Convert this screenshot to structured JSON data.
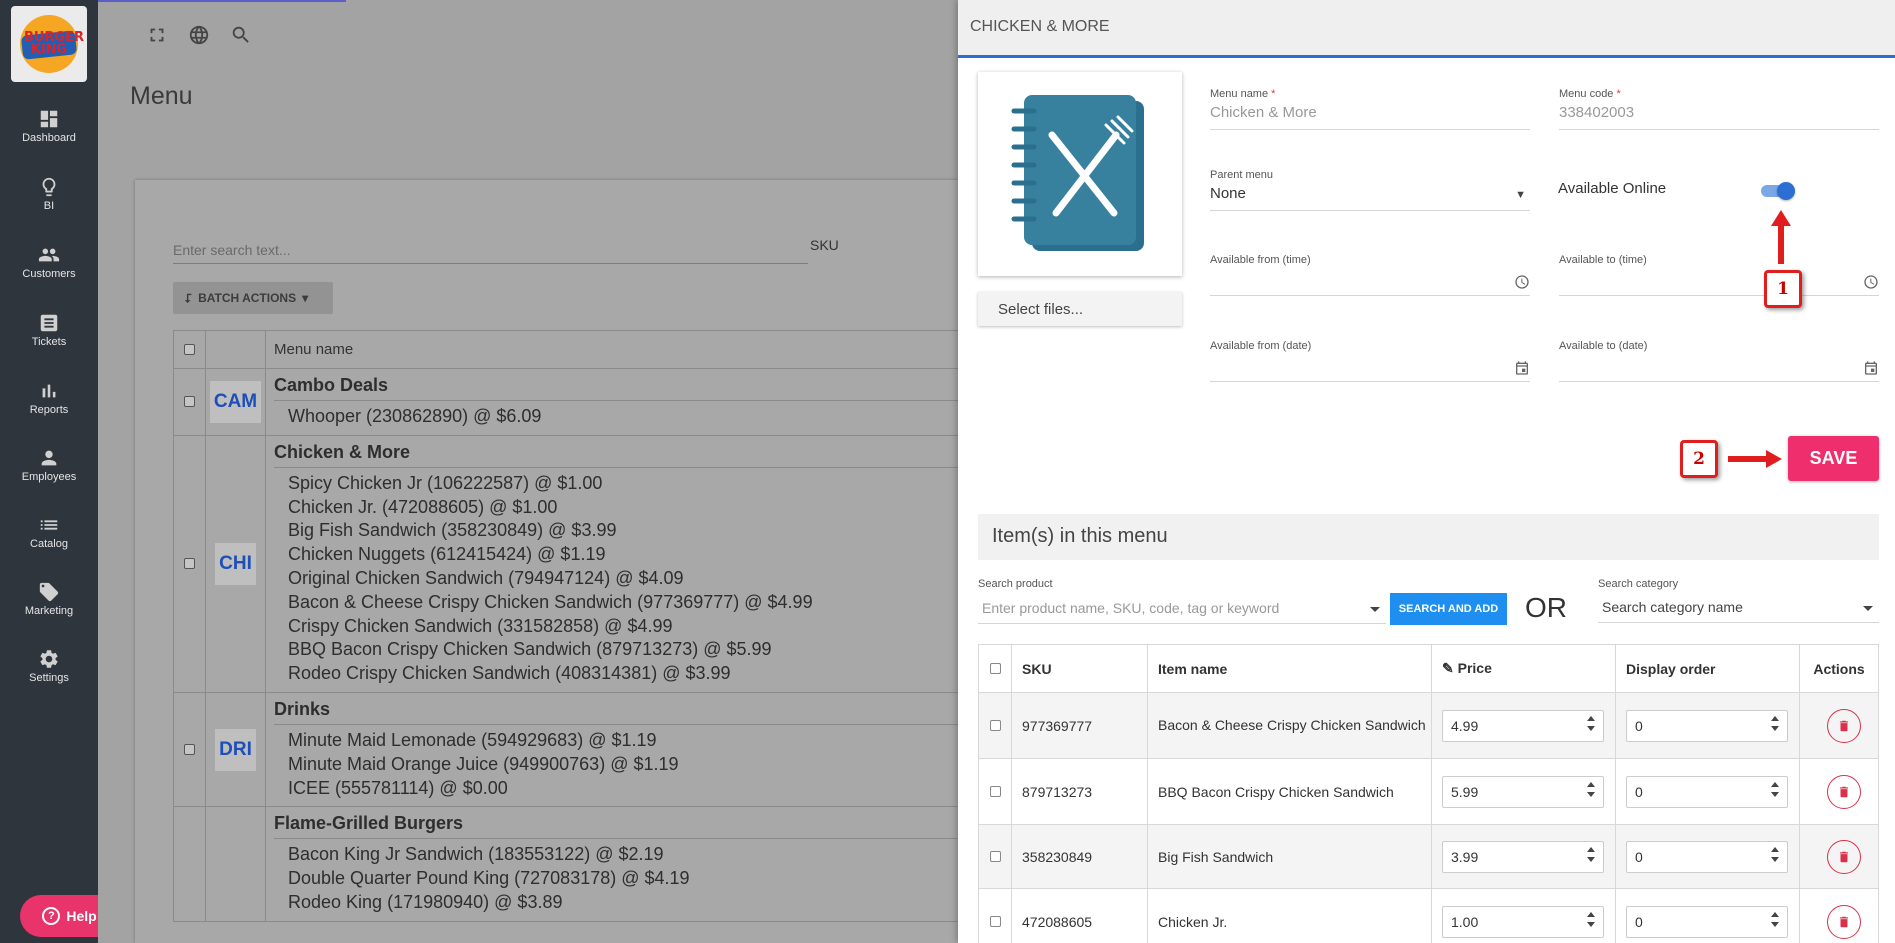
{
  "sidebar": {
    "logo_text": "BURGER KING",
    "items": [
      {
        "label": "Dashboard",
        "icon": "dashboard-icon"
      },
      {
        "label": "BI",
        "icon": "lightbulb-icon"
      },
      {
        "label": "Customers",
        "icon": "people-icon"
      },
      {
        "label": "Tickets",
        "icon": "ticket-icon"
      },
      {
        "label": "Reports",
        "icon": "bar-chart-icon"
      },
      {
        "label": "Employees",
        "icon": "person-icon"
      },
      {
        "label": "Catalog",
        "icon": "list-icon"
      },
      {
        "label": "Marketing",
        "icon": "tag-icon"
      },
      {
        "label": "Settings",
        "icon": "gear-icon"
      }
    ],
    "help_label": "Help"
  },
  "main": {
    "page_title": "Menu",
    "search_placeholder": "Enter search text...",
    "filter_label": "SKU",
    "batch_actions_label": "BATCH ACTIONS",
    "column_menu_name": "Menu name",
    "groups": [
      {
        "code": "CAM",
        "name": "Cambo Deals",
        "items": [
          "Whooper (230862890) @ $6.09"
        ]
      },
      {
        "code": "CHI",
        "name": "Chicken & More",
        "items": [
          "Spicy Chicken Jr (106222587) @ $1.00",
          "Chicken Jr. (472088605) @ $1.00",
          "Big Fish Sandwich (358230849) @ $3.99",
          "Chicken Nuggets (612415424) @ $1.19",
          "Original Chicken Sandwich (794947124) @ $4.09",
          "Bacon & Cheese Crispy Chicken Sandwich (977369777) @ $4.99",
          "Crispy Chicken Sandwich (331582858) @ $4.99",
          "BBQ Bacon Crispy Chicken Sandwich (879713273) @ $5.99",
          "Rodeo Crispy Chicken Sandwich (408314381) @ $3.99"
        ]
      },
      {
        "code": "DRI",
        "name": "Drinks",
        "items": [
          "Minute Maid Lemonade (594929683) @ $1.19",
          "Minute Maid Orange Juice (949900763) @ $1.19",
          "ICEE (555781114) @ $0.00"
        ]
      },
      {
        "code": "",
        "name": "Flame-Grilled Burgers",
        "items": [
          "Bacon King Jr Sandwich (183553122) @ $2.19",
          "Double Quarter Pound King (727083178) @ $4.19",
          "Rodeo King (171980940) @ $3.89"
        ]
      }
    ]
  },
  "panel": {
    "title": "CHICKEN & MORE",
    "select_files_label": "Select files...",
    "menu_name": {
      "label": "Menu name",
      "value": "Chicken & More"
    },
    "menu_code": {
      "label": "Menu code",
      "value": "338402003"
    },
    "required_mark": "*",
    "parent_menu": {
      "label": "Parent menu",
      "value": "None"
    },
    "available_online_label": "Available Online",
    "available_online": true,
    "available_from_time_label": "Available from (time)",
    "available_to_time_label": "Available to (time)",
    "available_from_date_label": "Available from (date)",
    "available_to_date_label": "Available to (date)",
    "annotation_1": "1",
    "annotation_2": "2",
    "save_label": "SAVE",
    "items_header": "Item(s) in this menu",
    "search_product_label": "Search product",
    "search_product_placeholder": "Enter product name, SKU, code, tag or keyword",
    "search_and_add_label": "SEARCH AND ADD",
    "or_label": "OR",
    "search_category_label": "Search category",
    "search_category_placeholder": "Search category name",
    "table": {
      "columns": [
        "SKU",
        "Item name",
        "Price",
        "Display order",
        "Actions"
      ],
      "rows": [
        {
          "sku": "977369777",
          "name": "Bacon & Cheese Crispy Chicken Sandwich",
          "price": "4.99",
          "order": "0"
        },
        {
          "sku": "879713273",
          "name": "BBQ Bacon Crispy Chicken Sandwich",
          "price": "5.99",
          "order": "0"
        },
        {
          "sku": "358230849",
          "name": "Big Fish Sandwich",
          "price": "3.99",
          "order": "0"
        },
        {
          "sku": "472088605",
          "name": "Chicken Jr.",
          "price": "1.00",
          "order": "0"
        }
      ]
    }
  },
  "colors": {
    "accent": "#2d6ed4",
    "save": "#ef2f6d",
    "search_add": "#1e8ff0",
    "annotation": "#e01e1e",
    "sidebar": "#2f353c"
  }
}
